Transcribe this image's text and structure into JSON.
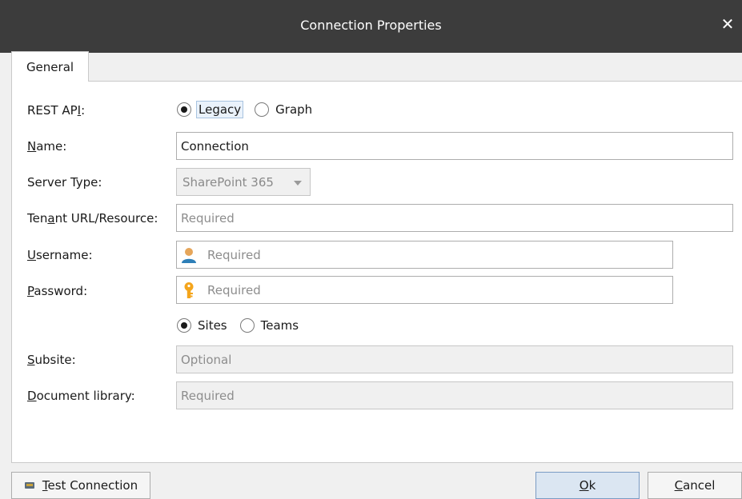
{
  "window": {
    "title": "Connection Properties",
    "close_glyph": "✕"
  },
  "tabs": [
    {
      "label": "General",
      "active": true
    }
  ],
  "form": {
    "rest_api": {
      "label": "REST API:",
      "options": [
        {
          "label": "Legacy",
          "selected": true
        },
        {
          "label": "Graph",
          "selected": false
        }
      ]
    },
    "name": {
      "label": "Name:",
      "value": "Connection"
    },
    "server_type": {
      "label": "Server Type:",
      "value": "SharePoint 365",
      "disabled": true
    },
    "tenant": {
      "label": "Tenant URL/Resource:",
      "placeholder": "Required"
    },
    "username": {
      "label": "Username:",
      "placeholder": "Required",
      "icon": "user-icon"
    },
    "password": {
      "label": "Password:",
      "placeholder": "Required",
      "icon": "key-icon"
    },
    "scope": {
      "options": [
        {
          "label": "Sites",
          "selected": true
        },
        {
          "label": "Teams",
          "selected": false
        }
      ]
    },
    "subsite": {
      "label": "Subsite:",
      "placeholder": "Optional",
      "disabled": true
    },
    "document_library": {
      "label": "Document library:",
      "placeholder": "Required",
      "disabled": true
    }
  },
  "footer": {
    "test_connection": {
      "label": "Test Connection",
      "icon": "plug-icon"
    },
    "ok": {
      "label": "Ok"
    },
    "cancel": {
      "label": "Cancel"
    }
  },
  "colors": {
    "titlebar": "#3c3c3c",
    "panel": "#ffffff",
    "background": "#f0f0f0",
    "primary_button": "#dbe6f2",
    "user_icon_head": "#e6a65a",
    "user_icon_body": "#2e7fb8",
    "key_icon": "#f4a51c"
  }
}
